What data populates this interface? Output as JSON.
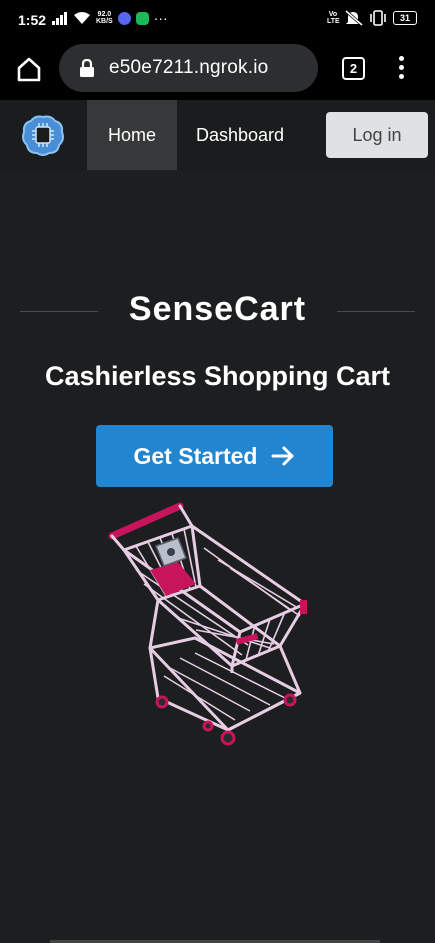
{
  "status_bar": {
    "time": "1:52",
    "net_speed_value": "92.0",
    "net_speed_unit": "KB/S",
    "more": "···",
    "volte": "Vo LTE",
    "battery": "31",
    "icons": [
      "signal-icon",
      "wifi-icon",
      "discord-icon",
      "messages-icon",
      "mute-icon",
      "vibrate-icon",
      "battery-icon"
    ],
    "colors": {
      "discord": "#5865f2",
      "messages": "#1eb85a"
    }
  },
  "browser": {
    "url": "e50e7211.ngrok.io",
    "tab_count": "2",
    "icons": [
      "home-icon",
      "lock-icon",
      "tabs-icon",
      "overflow-menu-icon"
    ]
  },
  "nav": {
    "items": [
      {
        "label": "Home",
        "active": true
      },
      {
        "label": "Dashboard",
        "active": false
      }
    ],
    "login": "Log in",
    "logo_icon": "chip-brain-logo-icon"
  },
  "hero": {
    "title": "SenseCart",
    "subtitle": "Cashierless Shopping Cart",
    "cta": "Get Started",
    "cta_icon": "arrow-right-icon",
    "illustration": "shopping-cart-illustration",
    "colors": {
      "cta": "#2185d0",
      "cart_accent": "#c8145a",
      "cart_frame": "#e6cde4"
    }
  }
}
